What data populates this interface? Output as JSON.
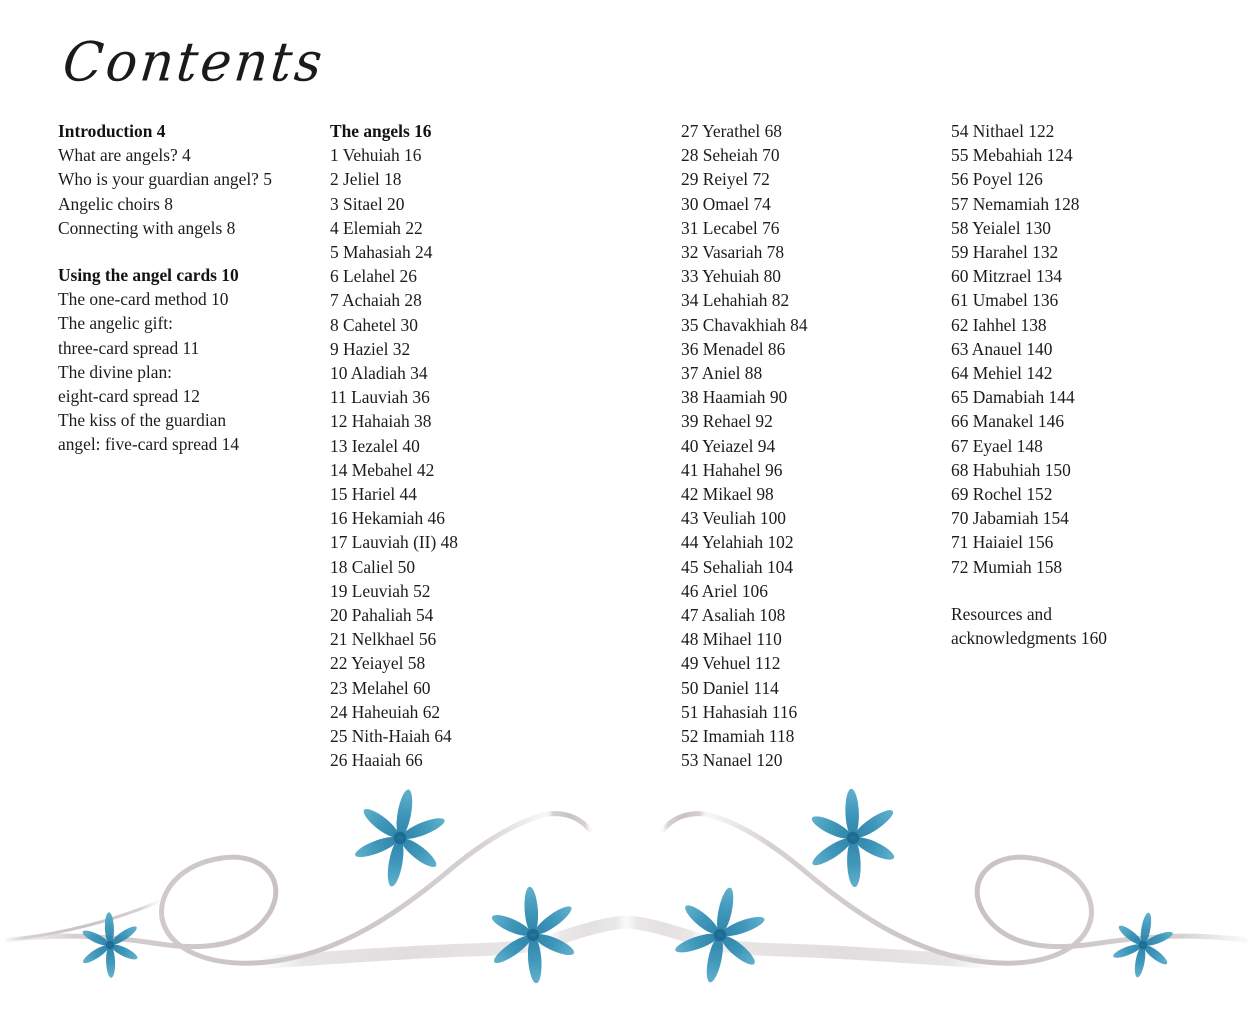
{
  "page": {
    "title": "Contents",
    "background_color": "#ffffff",
    "text_color": "#1a1a1a"
  },
  "decoration": {
    "name": "floral-ribbon-border",
    "ribbon_color": "#cfc8c9",
    "flower_color": "#2f8fb5",
    "flower_center_color": "#1d6d96",
    "flower_count": 6
  },
  "columns": [
    {
      "id": "column-1",
      "groups": [
        {
          "heading": "Introduction 4",
          "entries": [
            "What are angels? 4",
            "Who is your guardian angel? 5",
            "Angelic choirs 8",
            "Connecting with angels 8"
          ]
        },
        {
          "heading": "Using the angel cards 10",
          "entries": [
            "The one-card method 10",
            "The angelic gift:",
            "three-card spread 11",
            "The divine plan:",
            "eight-card spread 12",
            "The kiss of the guardian",
            "angel: five-card spread 14"
          ]
        }
      ]
    },
    {
      "id": "column-2",
      "groups": [
        {
          "heading": "The angels 16",
          "entries": [
            "1 Vehuiah 16",
            "2 Jeliel 18",
            "3 Sitael 20",
            "4 Elemiah 22",
            "5 Mahasiah 24",
            "6 Lelahel 26",
            "7 Achaiah 28",
            "8 Cahetel 30",
            "9 Haziel 32",
            "10 Aladiah 34",
            "11 Lauviah 36",
            "12 Hahaiah 38",
            "13 Iezalel 40",
            "14 Mebahel 42",
            "15 Hariel 44",
            "16 Hekamiah 46",
            "17 Lauviah (II) 48",
            "18 Caliel 50",
            "19 Leuviah 52",
            "20 Pahaliah 54",
            "21 Nelkhael 56",
            "22 Yeiayel 58",
            "23 Melahel 60",
            "24 Haheuiah 62",
            "25 Nith-Haiah 64",
            "26 Haaiah 66"
          ]
        }
      ]
    },
    {
      "id": "column-3",
      "groups": [
        {
          "heading": "",
          "entries": [
            "27 Yerathel 68",
            "28 Seheiah 70",
            "29 Reiyel 72",
            "30 Omael 74",
            "31 Lecabel 76",
            "32 Vasariah 78",
            "33 Yehuiah 80",
            "34 Lehahiah 82",
            "35 Chavakhiah 84",
            "36 Menadel 86",
            "37 Aniel 88",
            "38 Haamiah 90",
            "39 Rehael 92",
            "40 Yeiazel 94",
            "41 Hahahel 96",
            "42 Mikael 98",
            "43 Veuliah 100",
            "44 Yelahiah 102",
            "45 Sehaliah 104",
            "46 Ariel 106",
            "47 Asaliah 108",
            "48 Mihael 110",
            "49 Vehuel 112",
            "50 Daniel 114",
            "51 Hahasiah 116",
            "52 Imamiah 118",
            "53 Nanael 120"
          ]
        }
      ]
    },
    {
      "id": "column-4",
      "groups": [
        {
          "heading": "",
          "entries": [
            "54 Nithael 122",
            "55 Mebahiah 124",
            "56 Poyel 126",
            "57 Nemamiah 128",
            "58 Yeialel 130",
            "59 Harahel 132",
            "60 Mitzrael 134",
            "61 Umabel 136",
            "62 Iahhel 138",
            "63 Anauel 140",
            "64 Mehiel 142",
            "65 Damabiah 144",
            "66 Manakel 146",
            "67 Eyael 148",
            "68 Habuhiah 150",
            "69 Rochel 152",
            "70 Jabamiah 154",
            "71 Haiaiel 156",
            "72 Mumiah 158"
          ]
        },
        {
          "heading": "",
          "entries": [
            "Resources and",
            "acknowledgments 160"
          ]
        }
      ]
    }
  ]
}
